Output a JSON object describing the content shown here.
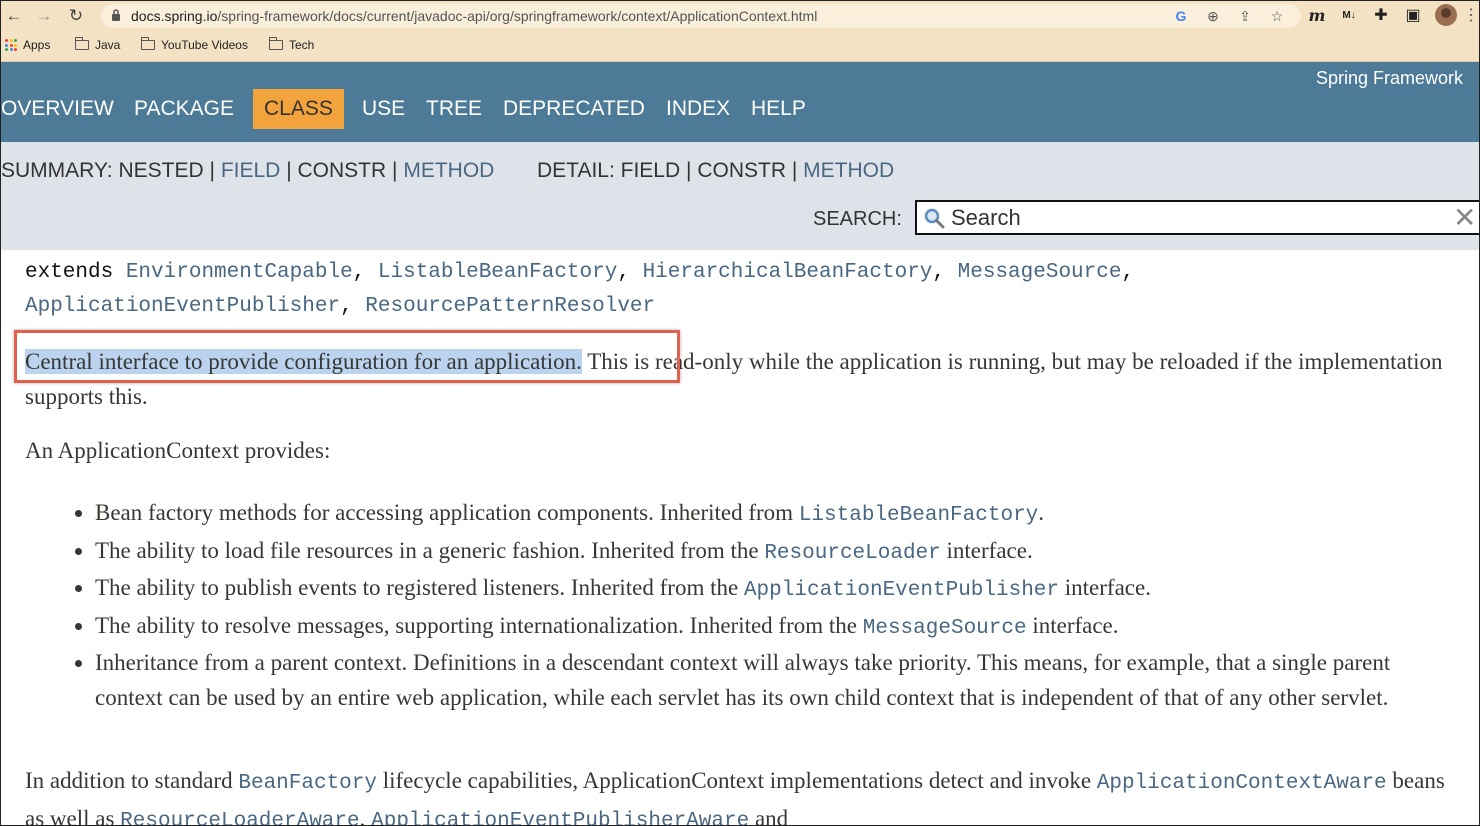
{
  "browser": {
    "url_host": "docs.spring.io",
    "url_path": "/spring-framework/docs/current/javadoc-api/org/springframework/context/ApplicationContext.html",
    "bookmarks": [
      "Apps",
      "Java",
      "YouTube Videos",
      "Tech"
    ]
  },
  "header": {
    "brand": "Spring Framework",
    "nav": [
      "OVERVIEW",
      "PACKAGE",
      "CLASS",
      "USE",
      "TREE",
      "DEPRECATED",
      "INDEX",
      "HELP"
    ],
    "active": "CLASS"
  },
  "subnav": {
    "summary_label": "SUMMARY:",
    "summary_nested": "NESTED",
    "summary_field": "FIELD",
    "summary_constr": "CONSTR",
    "summary_method": "METHOD",
    "detail_label": "DETAIL:",
    "detail_field": "FIELD",
    "detail_constr": "CONSTR",
    "detail_method": "METHOD",
    "separator": "|",
    "search_label": "SEARCH:",
    "search_placeholder": "Search"
  },
  "content": {
    "extends_keyword": "extends",
    "extends_types": [
      "EnvironmentCapable",
      "ListableBeanFactory",
      "HierarchicalBeanFactory",
      "MessageSource",
      "ApplicationEventPublisher",
      "ResourcePatternResolver"
    ],
    "intro_highlight": "Central interface to provide configuration for an application.",
    "intro_rest": " This is read-only while the application is running, but may be reloaded if the implementation supports this.",
    "provides": "An ApplicationContext provides:",
    "features": [
      {
        "pre": "Bean factory methods for accessing application components. Inherited from ",
        "code": "ListableBeanFactory",
        "post": "."
      },
      {
        "pre": "The ability to load file resources in a generic fashion. Inherited from the ",
        "code": "ResourceLoader",
        "post": " interface."
      },
      {
        "pre": "The ability to publish events to registered listeners. Inherited from the ",
        "code": "ApplicationEventPublisher",
        "post": " interface."
      },
      {
        "pre": "The ability to resolve messages, supporting internationalization. Inherited from the ",
        "code": "MessageSource",
        "post": " interface."
      },
      {
        "pre": "Inheritance from a parent context. Definitions in a descendant context will always take priority. This means, for example, that a single parent context can be used by an entire web application, while each servlet has its own child context that is independent of that of any other servlet.",
        "code": "",
        "post": ""
      }
    ],
    "lifecycle_pre": "In addition to standard ",
    "lifecycle_code1": "BeanFactory",
    "lifecycle_mid": " lifecycle capabilities, ApplicationContext implementations detect and invoke ",
    "lifecycle_code2": "ApplicationContextAware",
    "lifecycle_mid2": " beans as well as ",
    "lifecycle_code3": "ResourceLoaderAware",
    "lifecycle_sep": ", ",
    "lifecycle_code4": "ApplicationEventPublisherAware",
    "lifecycle_end": " and"
  },
  "colors": {
    "navbar": "#4d7a97",
    "active_tab": "#f2a33b",
    "subnav": "#dee3e9",
    "link": "#4a6782",
    "highlight": "#bcd3ef",
    "annotation_box": "#e0614d"
  }
}
